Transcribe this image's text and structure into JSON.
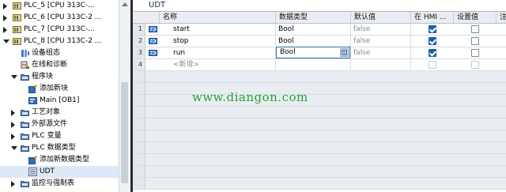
{
  "tree": {
    "items": [
      {
        "label": "PLC_5 [CPU 313C-...",
        "icon": "plc-device-icon",
        "expander": "right"
      },
      {
        "label": "PLC_6 [CPU 313C-2 ...",
        "icon": "plc-device-icon",
        "expander": "right"
      },
      {
        "label": "PLC_7 [CPU 313C-...",
        "icon": "plc-device-icon",
        "expander": "right"
      },
      {
        "label": "PLC_8 [CPU 313C-2 ...",
        "icon": "plc-device-icon",
        "expander": "down"
      },
      {
        "label": "设备组态",
        "icon": "device-config-icon",
        "expander": ""
      },
      {
        "label": "在线和诊断",
        "icon": "online-diagnostics-icon",
        "expander": ""
      },
      {
        "label": "程序块",
        "icon": "folder-icon",
        "expander": "down"
      },
      {
        "label": "添加新块",
        "icon": "add-block-icon",
        "expander": ""
      },
      {
        "label": "Main [OB1]",
        "icon": "block-icon",
        "expander": ""
      },
      {
        "label": "工艺对象",
        "icon": "folder-icon",
        "expander": "right"
      },
      {
        "label": "外部源文件",
        "icon": "folder-icon",
        "expander": "right"
      },
      {
        "label": "PLC 变量",
        "icon": "folder-icon",
        "expander": "right"
      },
      {
        "label": "PLC 数据类型",
        "icon": "folder-icon",
        "expander": "down"
      },
      {
        "label": "添加新数据类型",
        "icon": "add-type-icon",
        "expander": ""
      },
      {
        "label": "UDT",
        "icon": "udt-icon",
        "expander": ""
      },
      {
        "label": "监控与强制表",
        "icon": "folder-icon",
        "expander": "right"
      }
    ]
  },
  "editor": {
    "title": "UDT",
    "columns": [
      "名称",
      "数据类型",
      "默认值",
      "在 HMI ...",
      "设置值",
      "注"
    ],
    "rows": [
      {
        "num": "1",
        "name": "start",
        "type": "Bool",
        "default": "false",
        "hmi": true,
        "setpoint": false
      },
      {
        "num": "2",
        "name": "stop",
        "type": "Bool",
        "default": "false",
        "hmi": true,
        "setpoint": false
      },
      {
        "num": "3",
        "name": "run",
        "type": "Bool",
        "default": "false",
        "hmi": true,
        "setpoint": false
      },
      {
        "num": "4",
        "name": "<新增>",
        "type": "",
        "default": "",
        "hmi": false,
        "setpoint": false
      }
    ]
  },
  "watermark": "www.diangon.com",
  "colors": {
    "accent": "#1f5fa5",
    "watermark": "#24a33a",
    "selection": "#dde9f6"
  }
}
